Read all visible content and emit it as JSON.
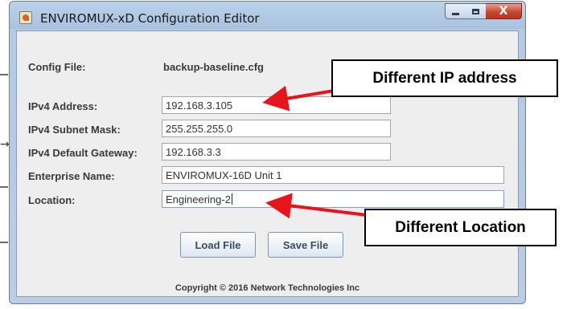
{
  "window": {
    "title": "ENVIROMUX-xD Configuration Editor",
    "close_symbol": "X"
  },
  "config_file": {
    "label": "Config File:",
    "value": "backup-baseline.cfg"
  },
  "fields": {
    "ipv4_address": {
      "label": "IPv4 Address:",
      "value": "192.168.3.105"
    },
    "subnet_mask": {
      "label": "IPv4 Subnet Mask:",
      "value": "255.255.255.0"
    },
    "gateway": {
      "label": "IPv4 Default Gateway:",
      "value": "192.168.3.3"
    },
    "enterprise_name": {
      "label": "Enterprise Name:",
      "value": "ENVIROMUX-16D Unit 1"
    },
    "location": {
      "label": "Location:",
      "value": "Engineering-2"
    }
  },
  "buttons": {
    "load": "Load File",
    "save": "Save File"
  },
  "footer": {
    "copyright": "Copyright © 2016 Network Technologies Inc"
  },
  "annotations": {
    "ip_callout": "Different IP address",
    "location_callout": "Different Location",
    "arrow_color": "#e8141c"
  },
  "colors": {
    "titlebar": "#bcd2ea",
    "client_bg": "#eeeeee",
    "close_button": "#c24a33"
  }
}
